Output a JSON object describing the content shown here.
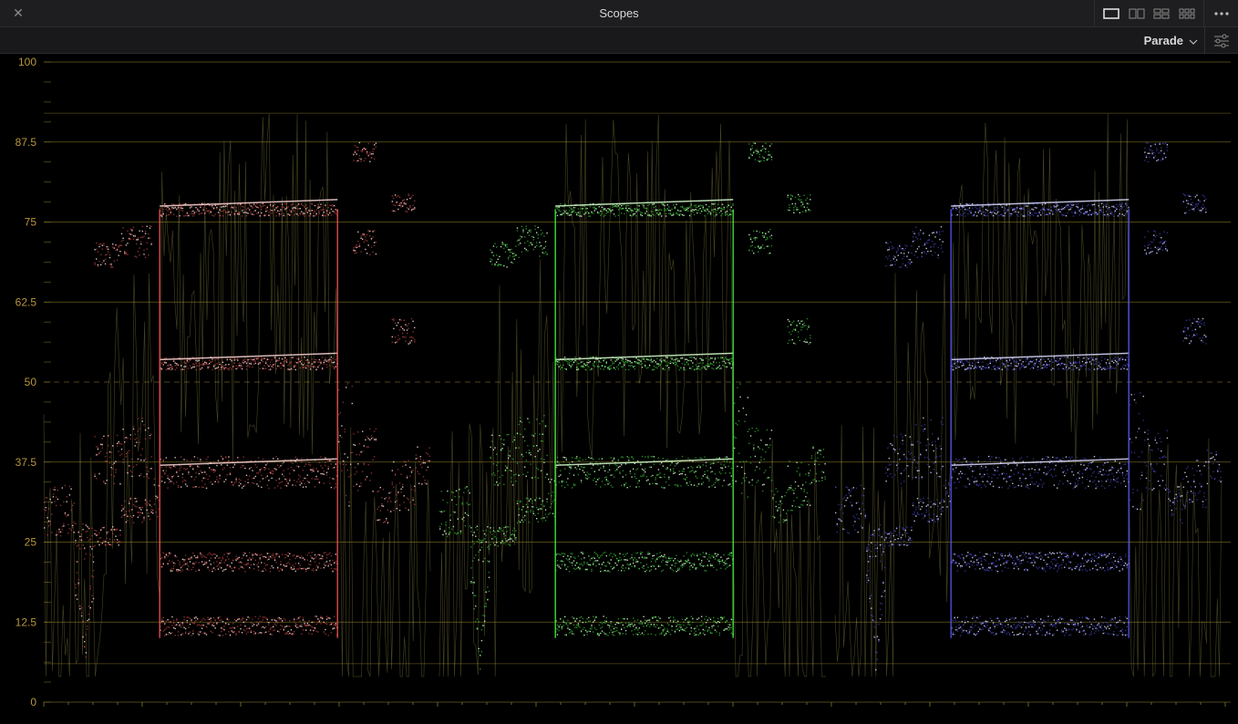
{
  "window": {
    "title": "Scopes",
    "close_glyph": "✕"
  },
  "header_icons": {
    "close": "close-icon",
    "layouts": [
      "single-layout-icon",
      "dual-layout-icon",
      "quad-layout-icon",
      "six-layout-icon"
    ],
    "more": "more-dots-icon",
    "settings": "sliders-icon"
  },
  "scope_mode": {
    "selected": "Parade"
  },
  "scale": {
    "labels": [
      "100",
      "87.5",
      "75",
      "62.5",
      "50",
      "37.5",
      "25",
      "12.5",
      "0"
    ],
    "values": [
      100,
      87.5,
      75,
      62.5,
      50,
      37.5,
      25,
      12.5,
      0
    ],
    "range": [
      0,
      100
    ]
  },
  "channels": [
    {
      "name": "red",
      "color": "#ff5a5a",
      "highlight": "#ffd8d8"
    },
    {
      "name": "green",
      "color": "#45ff45",
      "highlight": "#d8ffd0"
    },
    {
      "name": "blue",
      "color": "#5a5aff",
      "highlight": "#dcdcff"
    }
  ],
  "colors": {
    "graticule": "#8a7a2a",
    "label": "#b8963a",
    "luma_trace": "#d8d06a",
    "background": "#000000"
  }
}
